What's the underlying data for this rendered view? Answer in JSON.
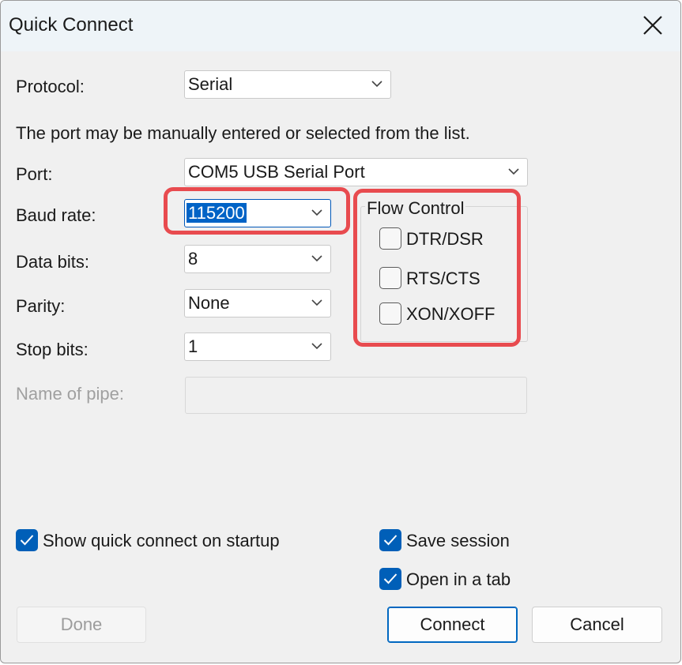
{
  "window": {
    "title": "Quick Connect"
  },
  "form": {
    "protocol_label": "Protocol:",
    "protocol_value": "Serial",
    "hint": "The port may be manually entered or selected from the list.",
    "port_label": "Port:",
    "port_value": "COM5 USB Serial Port",
    "baud_label": "Baud rate:",
    "baud_value": "115200",
    "databits_label": "Data bits:",
    "databits_value": "8",
    "parity_label": "Parity:",
    "parity_value": "None",
    "stopbits_label": "Stop bits:",
    "stopbits_value": "1",
    "pipe_label": "Name of pipe:",
    "pipe_value": ""
  },
  "flow_control": {
    "title": "Flow Control",
    "options": [
      {
        "label": "DTR/DSR",
        "checked": false
      },
      {
        "label": "RTS/CTS",
        "checked": false
      },
      {
        "label": "XON/XOFF",
        "checked": false
      }
    ]
  },
  "options": {
    "show_on_startup": {
      "label": "Show quick connect on startup",
      "checked": true
    },
    "save_session": {
      "label": "Save session",
      "checked": true
    },
    "open_in_tab": {
      "label": "Open in a tab",
      "checked": true
    }
  },
  "buttons": {
    "done": "Done",
    "connect": "Connect",
    "cancel": "Cancel"
  },
  "colors": {
    "accent": "#005fb8",
    "highlight": "#e84b4f",
    "selection": "#0063c6"
  },
  "icons": {
    "close": "close-icon",
    "chevron": "chevron-down-icon",
    "check": "checkmark-icon"
  }
}
